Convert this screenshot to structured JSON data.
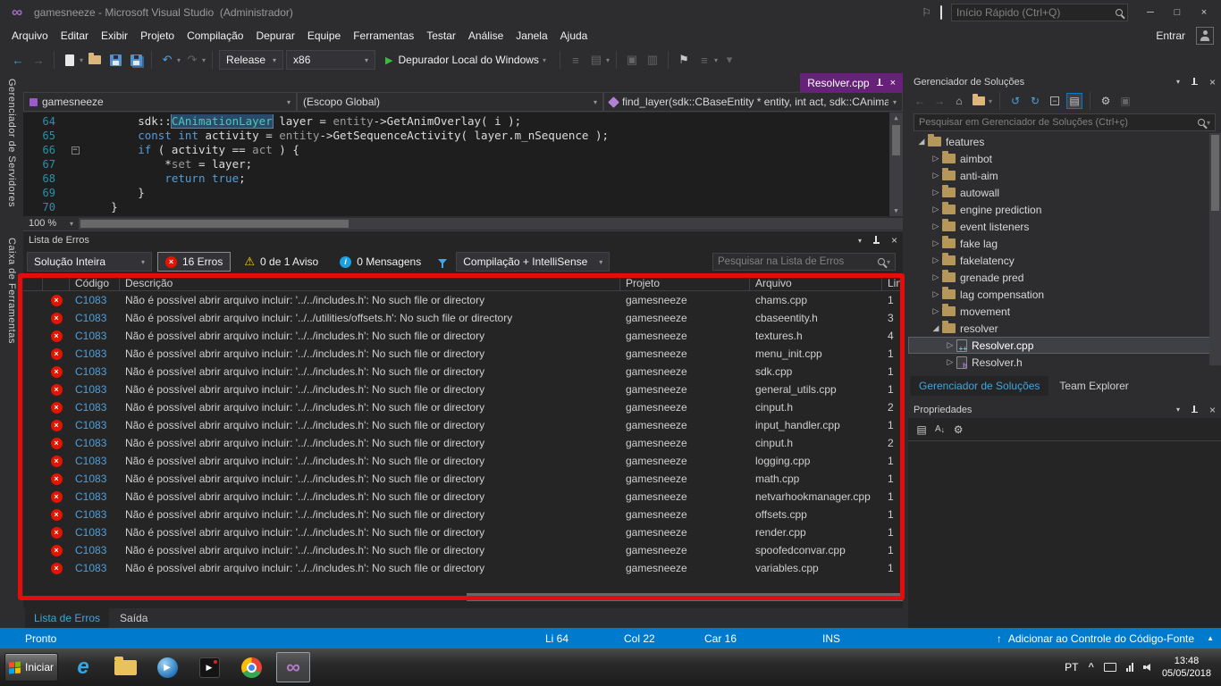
{
  "colors": {
    "accent": "#007acc",
    "chrome_bg": "#2d2d30",
    "editor_bg": "#1e1e1e",
    "panel_bg": "#252526",
    "status_bg": "#007acc",
    "preview_tab_purple": "#68217a",
    "error_red": "#e51400",
    "annotation_red": "#e60c0c",
    "keyword_blue": "#569cd6",
    "type_teal": "#4ec9b0",
    "line_number": "#2b91af",
    "link_blue": "#4f9fda",
    "folder_tan": "#b49759"
  },
  "icons": {
    "infinity": "∞",
    "flag_outline": "⚐",
    "flag": "⚑",
    "minimize": "─",
    "maximize": "□",
    "close": "×",
    "caret": "▾",
    "back": "←",
    "forward": "→",
    "undo": "↶",
    "redo": "↷",
    "play": "▶",
    "menu_list": "≡",
    "grid": "▤",
    "grid2": "▥",
    "box": "▣",
    "home": "⌂",
    "sync": "↺",
    "refresh": "↻",
    "gear": "⚙",
    "minus": "−",
    "warning": "⚠",
    "info_letter": "i",
    "scroll_up": "▲",
    "scroll_down": "▼",
    "up_arrow": "↑",
    "expand_up": "▲",
    "collapsed_arrow": "▷",
    "expanded_arrow": "◢",
    "cpp_badge": "++",
    "header_badge": "h",
    "letter_a": "A",
    "down_arrow": "↓",
    "ie_letter": "e",
    "tray_chevron": "^"
  },
  "titlebar": {
    "title": "gamesneeze - Microsoft Visual Studio  (Administrador)",
    "quick_launch_placeholder": "Início Rápido (Ctrl+Q)"
  },
  "menubar": {
    "items": [
      "Arquivo",
      "Editar",
      "Exibir",
      "Projeto",
      "Compilação",
      "Depurar",
      "Equipe",
      "Ferramentas",
      "Testar",
      "Análise",
      "Janela",
      "Ajuda"
    ],
    "sign_in": "Entrar"
  },
  "toolbar": {
    "configuration": "Release",
    "platform": "x86",
    "debug_target": "Depurador Local do Windows"
  },
  "side_strip": {
    "tabs": [
      "Gerenciador de Servidores",
      "Caixa de Ferramentas"
    ]
  },
  "editor": {
    "tab_title": "Resolver.cpp",
    "project_dropdown": "gamesneeze",
    "scope_dropdown": "(Escopo Global)",
    "member_dropdown": "find_layer(sdk::CBaseEntity * entity, int act, sdk::CAnimati",
    "zoom": "100 %",
    "code_lines": [
      {
        "num": "64",
        "segments": [
          {
            "t": "        sdk::",
            "c": "plain"
          },
          {
            "t": "CAnimationLayer",
            "c": "type",
            "hl": true
          },
          {
            "t": " layer = ",
            "c": "plain"
          },
          {
            "t": "entity",
            "c": "dim"
          },
          {
            "t": "->GetAnimOverlay( i );",
            "c": "plain"
          }
        ]
      },
      {
        "num": "65",
        "segments": [
          {
            "t": "        ",
            "c": "plain"
          },
          {
            "t": "const",
            "c": "kw"
          },
          {
            "t": " ",
            "c": "plain"
          },
          {
            "t": "int",
            "c": "kw"
          },
          {
            "t": " activity = ",
            "c": "plain"
          },
          {
            "t": "entity",
            "c": "dim"
          },
          {
            "t": "->GetSequenceActivity( layer.m_nSequence );",
            "c": "plain"
          }
        ]
      },
      {
        "num": "66",
        "fold": true,
        "segments": [
          {
            "t": "        ",
            "c": "plain"
          },
          {
            "t": "if",
            "c": "kw"
          },
          {
            "t": " ( activity == ",
            "c": "plain"
          },
          {
            "t": "act",
            "c": "dim"
          },
          {
            "t": " ) {",
            "c": "plain"
          }
        ]
      },
      {
        "num": "67",
        "segments": [
          {
            "t": "            *",
            "c": "plain"
          },
          {
            "t": "set",
            "c": "dim"
          },
          {
            "t": " = layer;",
            "c": "plain"
          }
        ]
      },
      {
        "num": "68",
        "segments": [
          {
            "t": "            ",
            "c": "plain"
          },
          {
            "t": "return",
            "c": "kw"
          },
          {
            "t": " ",
            "c": "plain"
          },
          {
            "t": "true",
            "c": "kw"
          },
          {
            "t": ";",
            "c": "plain"
          }
        ]
      },
      {
        "num": "69",
        "segments": [
          {
            "t": "        }",
            "c": "plain"
          }
        ]
      },
      {
        "num": "70",
        "segments": [
          {
            "t": "    }",
            "c": "plain"
          }
        ]
      }
    ]
  },
  "error_list": {
    "panel_title": "Lista de Erros",
    "scope_filter": "Solução Inteira",
    "errors_filter": "16 Erros",
    "warnings_filter": "0 de 1 Aviso",
    "messages_filter": "0 Mensagens",
    "source_filter": "Compilação + IntelliSense",
    "search_placeholder": "Pesquisar na Lista de Erros",
    "columns": {
      "code": "Código",
      "description": "Descrição",
      "project": "Projeto",
      "file": "Arquivo",
      "line": "Linha"
    },
    "rows": [
      {
        "code": "C1083",
        "description": "Não é possível abrir arquivo incluir: '../../includes.h': No such file or directory",
        "project": "gamesneeze",
        "file": "chams.cpp",
        "line": "1"
      },
      {
        "code": "C1083",
        "description": "Não é possível abrir arquivo incluir: '../../utilities/offsets.h': No such file or directory",
        "project": "gamesneeze",
        "file": "cbaseentity.h",
        "line": "3"
      },
      {
        "code": "C1083",
        "description": "Não é possível abrir arquivo incluir: '../../includes.h': No such file or directory",
        "project": "gamesneeze",
        "file": "textures.h",
        "line": "4"
      },
      {
        "code": "C1083",
        "description": "Não é possível abrir arquivo incluir: '../../includes.h': No such file or directory",
        "project": "gamesneeze",
        "file": "menu_init.cpp",
        "line": "1"
      },
      {
        "code": "C1083",
        "description": "Não é possível abrir arquivo incluir: '../../includes.h': No such file or directory",
        "project": "gamesneeze",
        "file": "sdk.cpp",
        "line": "1"
      },
      {
        "code": "C1083",
        "description": "Não é possível abrir arquivo incluir: '../../includes.h': No such file or directory",
        "project": "gamesneeze",
        "file": "general_utils.cpp",
        "line": "1"
      },
      {
        "code": "C1083",
        "description": "Não é possível abrir arquivo incluir: '../../includes.h': No such file or directory",
        "project": "gamesneeze",
        "file": "cinput.h",
        "line": "2"
      },
      {
        "code": "C1083",
        "description": "Não é possível abrir arquivo incluir: '../../includes.h': No such file or directory",
        "project": "gamesneeze",
        "file": "input_handler.cpp",
        "line": "1"
      },
      {
        "code": "C1083",
        "description": "Não é possível abrir arquivo incluir: '../../includes.h': No such file or directory",
        "project": "gamesneeze",
        "file": "cinput.h",
        "line": "2"
      },
      {
        "code": "C1083",
        "description": "Não é possível abrir arquivo incluir: '../../includes.h': No such file or directory",
        "project": "gamesneeze",
        "file": "logging.cpp",
        "line": "1"
      },
      {
        "code": "C1083",
        "description": "Não é possível abrir arquivo incluir: '../../includes.h': No such file or directory",
        "project": "gamesneeze",
        "file": "math.cpp",
        "line": "1"
      },
      {
        "code": "C1083",
        "description": "Não é possível abrir arquivo incluir: '../../includes.h': No such file or directory",
        "project": "gamesneeze",
        "file": "netvarhookmanager.cpp",
        "line": "1"
      },
      {
        "code": "C1083",
        "description": "Não é possível abrir arquivo incluir: '../../includes.h': No such file or directory",
        "project": "gamesneeze",
        "file": "offsets.cpp",
        "line": "1"
      },
      {
        "code": "C1083",
        "description": "Não é possível abrir arquivo incluir: '../../includes.h': No such file or directory",
        "project": "gamesneeze",
        "file": "render.cpp",
        "line": "1"
      },
      {
        "code": "C1083",
        "description": "Não é possível abrir arquivo incluir: '../../includes.h': No such file or directory",
        "project": "gamesneeze",
        "file": "spoofedconvar.cpp",
        "line": "1"
      },
      {
        "code": "C1083",
        "description": "Não é possível abrir arquivo incluir: '../../includes.h': No such file or directory",
        "project": "gamesneeze",
        "file": "variables.cpp",
        "line": "1"
      }
    ]
  },
  "bottom_tabs": [
    "Lista de Erros",
    "Saída"
  ],
  "solution_explorer": {
    "panel_title": "Gerenciador de Soluções",
    "search_placeholder": "Pesquisar em Gerenciador de Soluções (Ctrl+ç)",
    "tree": [
      {
        "label": "features",
        "indent": 0,
        "arrow": "expanded",
        "icon": "folder"
      },
      {
        "label": "aimbot",
        "indent": 1,
        "arrow": "collapsed",
        "icon": "folder"
      },
      {
        "label": "anti-aim",
        "indent": 1,
        "arrow": "collapsed",
        "icon": "folder"
      },
      {
        "label": "autowall",
        "indent": 1,
        "arrow": "collapsed",
        "icon": "folder"
      },
      {
        "label": "engine prediction",
        "indent": 1,
        "arrow": "collapsed",
        "icon": "folder"
      },
      {
        "label": "event listeners",
        "indent": 1,
        "arrow": "collapsed",
        "icon": "folder"
      },
      {
        "label": "fake lag",
        "indent": 1,
        "arrow": "collapsed",
        "icon": "folder"
      },
      {
        "label": "fakelatency",
        "indent": 1,
        "arrow": "collapsed",
        "icon": "folder"
      },
      {
        "label": "grenade pred",
        "indent": 1,
        "arrow": "collapsed",
        "icon": "folder"
      },
      {
        "label": "lag compensation",
        "indent": 1,
        "arrow": "collapsed",
        "icon": "folder"
      },
      {
        "label": "movement",
        "indent": 1,
        "arrow": "collapsed",
        "icon": "folder"
      },
      {
        "label": "resolver",
        "indent": 1,
        "arrow": "expanded",
        "icon": "folder"
      },
      {
        "label": "Resolver.cpp",
        "indent": 2,
        "arrow": "collapsed",
        "icon": "cpp",
        "selected": true
      },
      {
        "label": "Resolver.h",
        "indent": 2,
        "arrow": "collapsed",
        "icon": "header"
      }
    ],
    "tabs": [
      "Gerenciador de Soluções",
      "Team Explorer"
    ]
  },
  "properties_panel": {
    "panel_title": "Propriedades"
  },
  "status_bar": {
    "state": "Pronto",
    "line": "Li 64",
    "column": "Col 22",
    "character": "Car 16",
    "mode": "INS",
    "source_control": "Adicionar ao Controle do Código-Fonte"
  },
  "taskbar": {
    "start": "Iniciar",
    "language": "PT",
    "time": "13:48",
    "date": "05/05/2018"
  }
}
